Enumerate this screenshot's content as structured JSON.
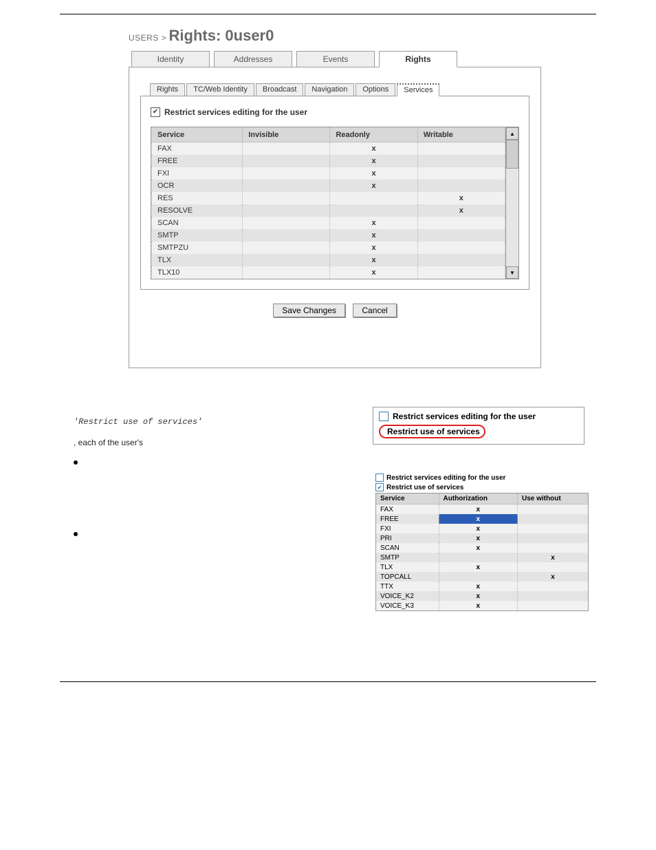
{
  "breadcrumb": {
    "prefix": "USERS >",
    "title": "Rights: 0user0"
  },
  "outer_tabs": [
    "Identity",
    "Addresses",
    "Events",
    "Rights"
  ],
  "outer_active": 3,
  "inner_tabs": [
    "Rights",
    "TC/Web Identity",
    "Broadcast",
    "Navigation",
    "Options",
    "Services"
  ],
  "inner_active": 5,
  "restrict_edit": {
    "checked": true,
    "label": "Restrict services editing for the user"
  },
  "svc_cols": [
    "Service",
    "Invisible",
    "Readonly",
    "Writable"
  ],
  "svc_rows": [
    {
      "svc": "FAX",
      "inv": "",
      "ro": "x",
      "wr": ""
    },
    {
      "svc": "FREE",
      "inv": "",
      "ro": "x",
      "wr": ""
    },
    {
      "svc": "FXI",
      "inv": "",
      "ro": "x",
      "wr": ""
    },
    {
      "svc": "OCR",
      "inv": "",
      "ro": "x",
      "wr": ""
    },
    {
      "svc": "RES",
      "inv": "",
      "ro": "",
      "wr": "x"
    },
    {
      "svc": "RESOLVE",
      "inv": "",
      "ro": "",
      "wr": "x"
    },
    {
      "svc": "SCAN",
      "inv": "",
      "ro": "x",
      "wr": ""
    },
    {
      "svc": "SMTP",
      "inv": "",
      "ro": "x",
      "wr": ""
    },
    {
      "svc": "SMTPZU",
      "inv": "",
      "ro": "x",
      "wr": ""
    },
    {
      "svc": "TLX",
      "inv": "",
      "ro": "x",
      "wr": ""
    },
    {
      "svc": "TLX10",
      "inv": "",
      "ro": "x",
      "wr": ""
    }
  ],
  "buttons": {
    "save": "Save Changes",
    "cancel": "Cancel"
  },
  "scroll": {
    "up": "▲",
    "down": "▼"
  },
  "body": {
    "quote": "'Restrict use of services'",
    "frag": ", each of the user's"
  },
  "figA": {
    "line1": "Restrict services editing for the user",
    "line2": "Restrict use of services"
  },
  "figB": {
    "chk1": {
      "checked": false,
      "label": "Restrict services editing for the user"
    },
    "chk2": {
      "checked": true,
      "label": "Restrict use of services"
    },
    "cols": [
      "Service",
      "Authorization",
      "Use without"
    ],
    "rows": [
      {
        "svc": "FAX",
        "a": "x",
        "b": "",
        "sel": false
      },
      {
        "svc": "FREE",
        "a": "x",
        "b": "",
        "sel": true
      },
      {
        "svc": "FXI",
        "a": "x",
        "b": "",
        "sel": false
      },
      {
        "svc": "PRI",
        "a": "x",
        "b": "",
        "sel": false
      },
      {
        "svc": "SCAN",
        "a": "x",
        "b": "",
        "sel": false
      },
      {
        "svc": "SMTP",
        "a": "",
        "b": "x",
        "sel": false
      },
      {
        "svc": "TLX",
        "a": "x",
        "b": "",
        "sel": false
      },
      {
        "svc": "TOPCALL",
        "a": "",
        "b": "x",
        "sel": false
      },
      {
        "svc": "TTX",
        "a": "x",
        "b": "",
        "sel": false
      },
      {
        "svc": "VOICE_K2",
        "a": "x",
        "b": "",
        "sel": false
      },
      {
        "svc": "VOICE_K3",
        "a": "x",
        "b": "",
        "sel": false
      }
    ]
  }
}
